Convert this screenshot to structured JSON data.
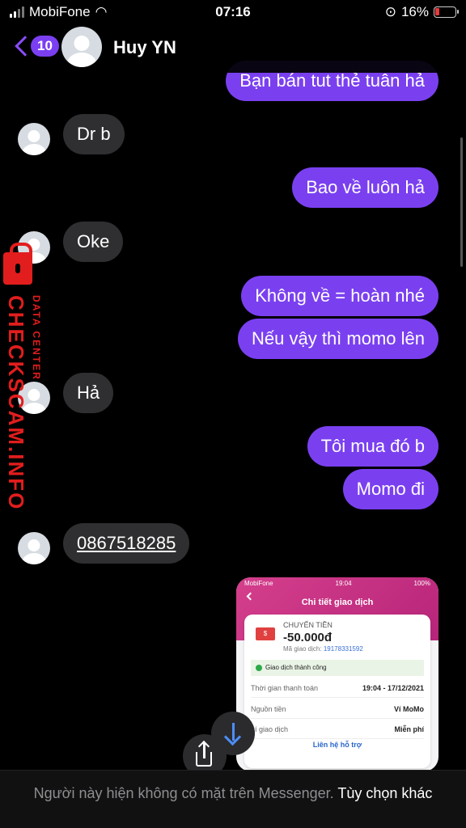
{
  "status_bar": {
    "carrier": "MobiFone",
    "time": "07:16",
    "battery": "16%"
  },
  "header": {
    "unread_count": "10",
    "contact_name": "Huy YN"
  },
  "messages": [
    {
      "from": "me",
      "text": "Bạn bán tut thẻ tuân hả"
    },
    {
      "from": "them",
      "text": "Dr b"
    },
    {
      "from": "me",
      "text": "Bao về luôn hả"
    },
    {
      "from": "them",
      "text": "Oke"
    },
    {
      "from": "me",
      "text": "Không về = hoàn nhé"
    },
    {
      "from": "me",
      "text": "Nếu vậy thì momo lên"
    },
    {
      "from": "them",
      "text": "Hả"
    },
    {
      "from": "me",
      "text": "Tôi mua đó b"
    },
    {
      "from": "me",
      "text": "Momo đi"
    },
    {
      "from": "them",
      "text": "0867518285"
    }
  ],
  "watermark": {
    "brand": "CHECKSCAM.INFO",
    "sub": "DATA CENTER"
  },
  "attachment": {
    "carrier": "MobiFone",
    "time": "19:04",
    "battery": "100%",
    "title": "Chi tiết giao dịch",
    "type": "CHUYỂN TIỀN",
    "amount": "-50.000đ",
    "code_label": "Mã giao dịch:",
    "code": "19178331592",
    "status": "Giao dịch thành công",
    "rows": [
      {
        "label": "Thời gian thanh toán",
        "value": "19:04 - 17/12/2021"
      },
      {
        "label": "Nguồn tiền",
        "value": "Ví MoMo"
      },
      {
        "label": "hí giao dịch",
        "value": "Miễn phí"
      }
    ],
    "support": "Liên hệ hỗ trợ"
  },
  "footer": {
    "notice": "Người này hiện không có mặt trên Messenger.",
    "options": "Tùy chọn khác"
  },
  "colors": {
    "outgoing": "#7a40f0",
    "incoming": "#2f2f31",
    "accent": "#8a4cff"
  }
}
